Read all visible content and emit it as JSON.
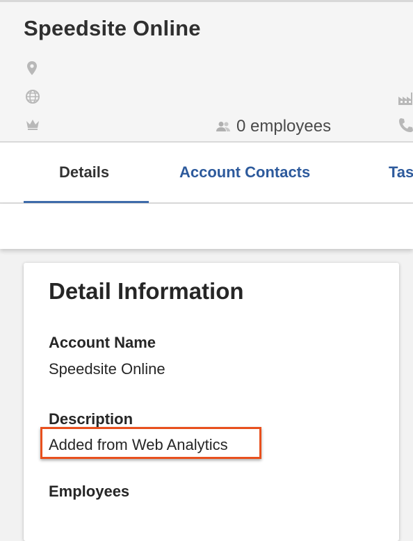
{
  "header": {
    "title": "Speedsite Online",
    "employees": "0 employees",
    "icons": [
      "location-pin-icon",
      "globe-icon",
      "crown-icon",
      "factory-icon",
      "phone-icon",
      "people-icon"
    ]
  },
  "tabs": [
    {
      "label": "Details",
      "active": true
    },
    {
      "label": "Account Contacts",
      "active": false
    },
    {
      "label": "Tas",
      "active": false
    }
  ],
  "detail_card": {
    "title": "Detail Information",
    "fields": [
      {
        "label": "Account Name",
        "value": "Speedsite Online"
      },
      {
        "label": "Description",
        "value": "Added from Web Analytics",
        "highlighted": true
      },
      {
        "label": "Employees",
        "value": ""
      }
    ]
  },
  "colors": {
    "accent": "#3f6cab",
    "tab_link": "#2d5a9c",
    "highlight_border": "#e8501d"
  }
}
